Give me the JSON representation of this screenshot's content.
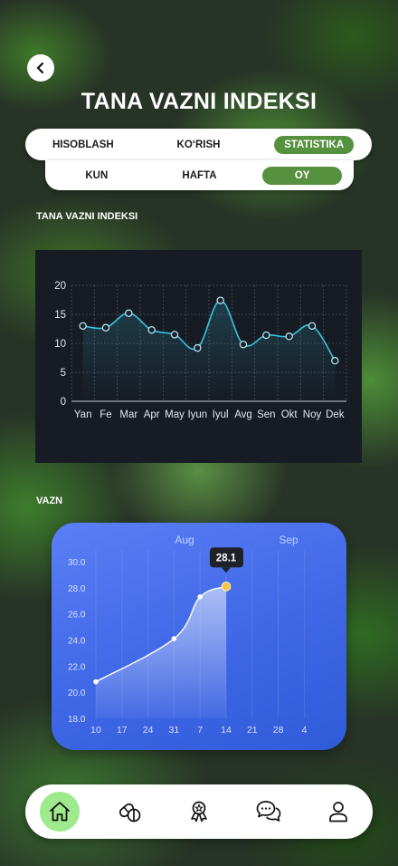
{
  "header": {
    "title": "TANA VAZNI INDEKSI",
    "back_icon": "chevron-left-icon"
  },
  "main_tabs": [
    {
      "label": "HISOBLASH",
      "active": false
    },
    {
      "label": "KO‘RISH",
      "active": false
    },
    {
      "label": "STATISTIKA",
      "active": true
    }
  ],
  "period_tabs": [
    {
      "label": "KUN",
      "active": false
    },
    {
      "label": "HAFTA",
      "active": false
    },
    {
      "label": "OY",
      "active": true
    }
  ],
  "colors": {
    "accent_green": "#55913e",
    "line_cyan": "#35c4e0",
    "card_blue": "#4470ea",
    "marker_yellow": "#f5c542"
  },
  "bmi_section": {
    "label": "TANA VAZNI INDEKSI"
  },
  "weight_section": {
    "label": "VAZN"
  },
  "chart_data": [
    {
      "type": "line",
      "categories": [
        "Yan",
        "Fe",
        "Mar",
        "Apr",
        "May",
        "Iyun",
        "Iyul",
        "Avg",
        "Sen",
        "Okt",
        "Noy",
        "Dek"
      ],
      "values": [
        13,
        12.7,
        15.2,
        12.3,
        11.5,
        9.2,
        17.4,
        9.8,
        11.4,
        11.2,
        13,
        7
      ],
      "ylim": [
        0,
        20
      ],
      "yticks": [
        0,
        5,
        10,
        15,
        20
      ],
      "grid": true
    },
    {
      "type": "area",
      "x": [
        10,
        31,
        7,
        14
      ],
      "values": [
        20.8,
        24.1,
        27.3,
        28.1
      ],
      "xticks": [
        "10",
        "17",
        "24",
        "31",
        "7",
        "14",
        "21",
        "28",
        "4"
      ],
      "month_labels": [
        "Aug",
        "Sep"
      ],
      "yticks": [
        "30.0",
        "28.0",
        "26.0",
        "24.0",
        "22.0",
        "20.0",
        "18.0"
      ],
      "ylim": [
        18,
        30
      ],
      "highlight_label": "28.1"
    }
  ],
  "bottom_nav": [
    {
      "icon": "home-icon",
      "active": true
    },
    {
      "icon": "pills-icon",
      "active": false
    },
    {
      "icon": "award-icon",
      "active": false
    },
    {
      "icon": "chat-icon",
      "active": false
    },
    {
      "icon": "profile-icon",
      "active": false
    }
  ]
}
